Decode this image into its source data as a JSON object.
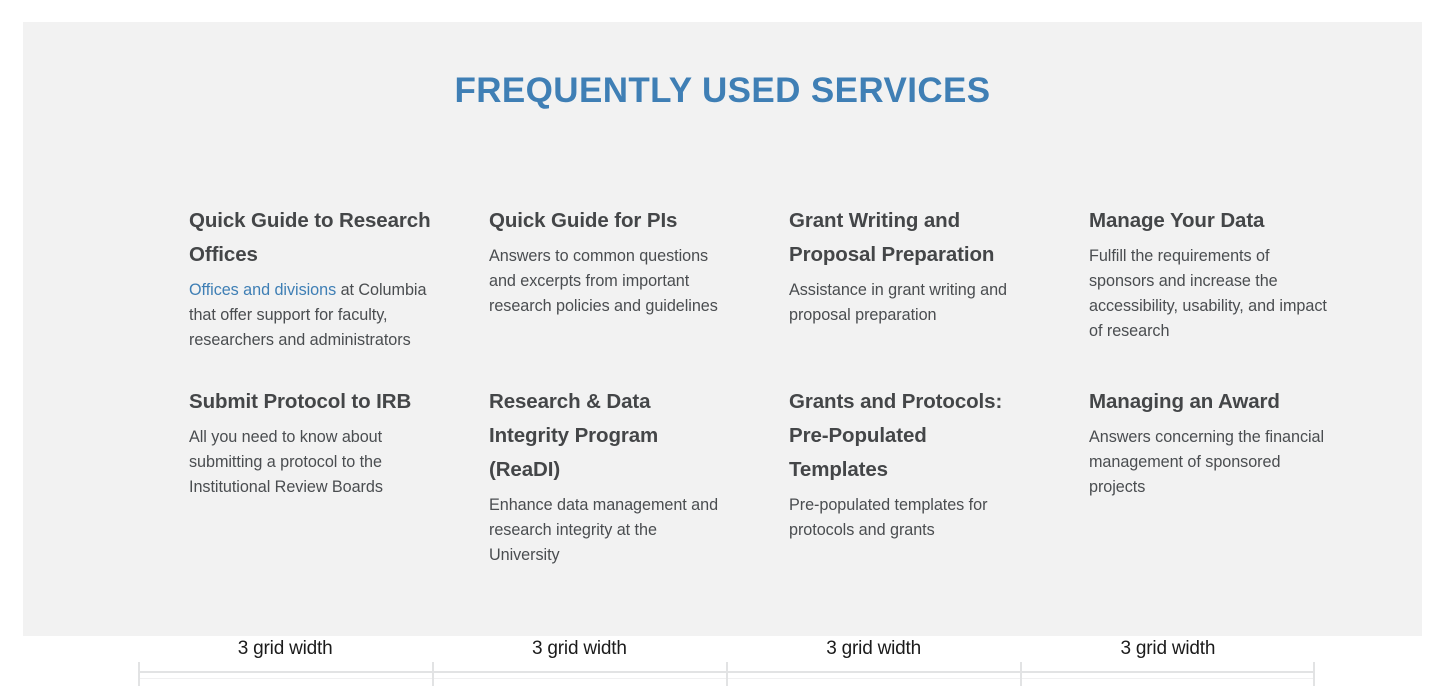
{
  "panel": {
    "title": "FREQUENTLY USED SERVICES",
    "background_color": "#f2f2f2",
    "accent_color": "#3f7fb5",
    "heading_color": "#444648",
    "body_color": "#4a4d50"
  },
  "cards": [
    {
      "title": "Quick Guide to Research Offices",
      "desc_link": "Offices and divisions",
      "desc_rest": " at Columbia that offer support for faculty, researchers and administrators"
    },
    {
      "title": "Quick Guide for PIs",
      "desc": "Answers to common questions and excerpts from important research policies and guidelines"
    },
    {
      "title": "Grant Writing and Proposal Preparation",
      "desc": "Assistance in grant writing and proposal preparation"
    },
    {
      "title": "Manage Your Data",
      "desc": "Fulfill the requirements of sponsors and increase the accessibility, usability, and impact of research"
    },
    {
      "title": "Submit Protocol to IRB",
      "desc": "All you need to know about submitting a protocol to the Institutional Review Boards"
    },
    {
      "title": "Research & Data Integrity Program (ReaDI)",
      "desc": "Enhance data management and research integrity at the University"
    },
    {
      "title": "Grants and Protocols: Pre-Populated Templates",
      "desc": "Pre-populated templates for protocols and grants"
    },
    {
      "title": "Managing an Award",
      "desc": "Answers concerning the financial management of sponsored projects"
    }
  ],
  "ruler": {
    "labels": [
      "3 grid width",
      "3 grid width",
      "3 grid width",
      "3 grid width"
    ]
  }
}
